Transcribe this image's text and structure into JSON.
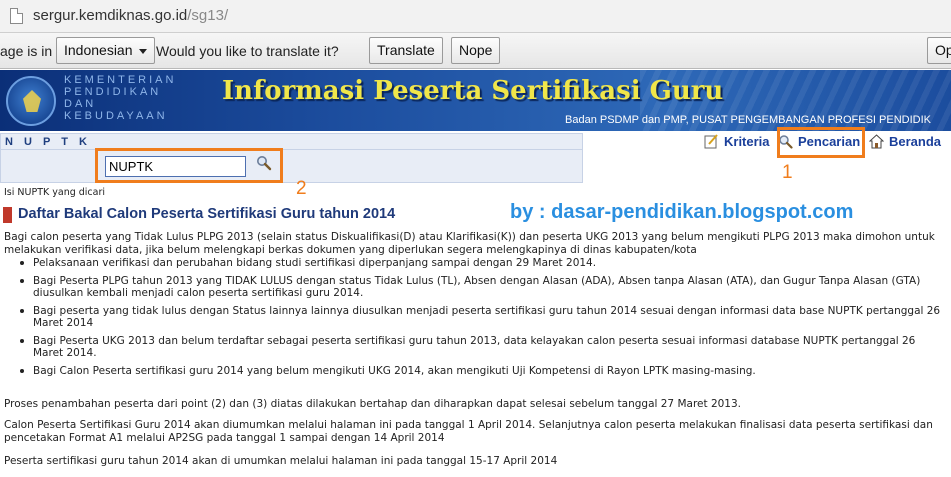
{
  "browser": {
    "url_domain": "sergur.kemdiknas.go.id",
    "url_path": "/sg13/"
  },
  "translate_bar": {
    "prefix_text": "age is in",
    "language": "Indonesian",
    "question": "Would you like to translate it?",
    "translate_label": "Translate",
    "nope_label": "Nope",
    "options_label": "Op"
  },
  "banner": {
    "ministry_lines": [
      "KEMENTERIAN",
      "PENDIDIKAN",
      "DAN",
      "KEBUDAYAAN"
    ],
    "title": "Informasi Peserta Sertifikasi Guru",
    "subtitle": "Badan PSDMP dan PMP, PUSAT PENGEMBANGAN PROFESI PENDIDIK"
  },
  "search": {
    "section_label": "N U P T K",
    "input_value": "NUPTK",
    "hint": "Isi NUPTK yang dicari"
  },
  "nav": {
    "kriteria": "Kriteria",
    "pencarian": "Pencarian",
    "beranda": "Beranda"
  },
  "annotations": {
    "num_1": "1",
    "num_2": "2",
    "watermark": "by : dasar-pendidikan.blogspot.com"
  },
  "content": {
    "heading": "Daftar Bakal Calon Peserta Sertifikasi Guru tahun 2014",
    "intro": "Bagi calon peserta yang Tidak Lulus PLPG 2013 (selain status Diskualifikasi(D) atau Klarifikasi(K)) dan peserta UKG 2013 yang belum mengikuti PLPG 2013 maka dimohon untuk melakukan verifikasi data, jika belum melengkapi berkas dokumen yang diperlukan segera melengkapinya di dinas kabupaten/kota",
    "bullets": [
      "Pelaksanaan verifikasi dan perubahan bidang studi sertifikasi diperpanjang sampai dengan 29 Maret 2014.",
      "Bagi Peserta PLPG tahun 2013 yang TIDAK LULUS dengan status Tidak Lulus (TL), Absen dengan Alasan (ADA), Absen tanpa Alasan (ATA), dan Gugur Tanpa Alasan (GTA) diusulkan kembali menjadi calon peserta sertifikasi guru 2014.",
      "Bagi peserta yang tidak lulus dengan Status lainnya lainnya diusulkan menjadi peserta sertifikasi guru tahun 2014 sesuai dengan informasi data base NUPTK pertanggal 26 Maret 2014",
      "Bagi Peserta UKG 2013 dan belum terdaftar sebagai peserta sertifikasi guru tahun 2013, data kelayakan calon peserta sesuai informasi database NUPTK pertanggal 26 Maret 2014.",
      "Bagi Calon Peserta sertifikasi guru 2014 yang belum mengikuti UKG 2014, akan mengikuti Uji Kompetensi di Rayon LPTK masing-masing."
    ],
    "para1": "Proses penambahan peserta dari point (2) dan (3) diatas dilakukan bertahap dan diharapkan dapat selesai sebelum tanggal 27 Maret 2013.",
    "para2": "Calon Peserta Sertifikasi Guru 2014 akan diumumkan melalui halaman ini pada tanggal 1 April 2014. Selanjutnya calon peserta melakukan finalisasi data peserta sertifikasi dan pencetakan Format A1 melalui AP2SG pada tanggal 1 sampai dengan 14 April 2014",
    "para3": "Peserta sertifikasi guru tahun 2014 akan di umumkan melalui halaman ini pada tanggal 15-17 April 2014"
  },
  "colors": {
    "highlight": "#f07d1c",
    "banner_title": "#f0e64a",
    "link": "#1a3f9a",
    "watermark": "#2a8fe0"
  }
}
